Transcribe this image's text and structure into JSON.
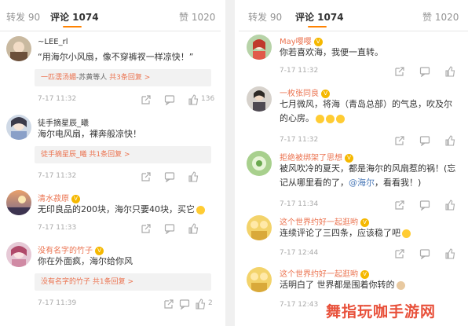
{
  "left": {
    "tabs": {
      "repost": "转发 90",
      "comments": "评论 1074",
      "likes": "赞 1020"
    },
    "comments": [
      {
        "username": "~LEE_rl",
        "text": "“用海尔小风扇，像不穿裤衩一样凉快！”",
        "reply_name": "一匹濡汤媚",
        "reply_sep": "-苏黄等人",
        "reply_count": "共3条回复",
        "time": "7-17 11:32",
        "likes": "136"
      },
      {
        "username": "徒手摘星辰_曦",
        "text": "海尔电风扇，裸奔般凉快！",
        "reply_name": "徒手摘星辰_曦",
        "reply_sep": "",
        "reply_count": "共1条回复",
        "time": "7-17 11:32",
        "likes": ""
      },
      {
        "username": "清水菽原",
        "text": "无印良品的200块，海尔只要40块，买它",
        "time": "7-17 11:33",
        "likes": ""
      },
      {
        "username": "没有名字的竹子",
        "text": "你在外面疯，海尔给你风",
        "reply_name": "没有名字的竹子",
        "reply_sep": "",
        "reply_count": "共1条回复",
        "time": "7-17 11:39",
        "likes": "2"
      }
    ]
  },
  "right": {
    "tabs": {
      "repost": "转发 90",
      "comments": "评论 1074",
      "likes": "赞 1020"
    },
    "comments": [
      {
        "username": "May嘤嘤",
        "text": "你若喜欢海，我便一直转。",
        "time": "7-17 11:32"
      },
      {
        "username": "一枚张同良",
        "text": "七月微风，将海（青岛总部）的气息，吹及尔的心房。",
        "time": "7-17 11:32"
      },
      {
        "username": "拒绝被绑架了思想",
        "text_before": "被风吹冷的夏天，都是海尔的风扇惹的祸！(忘记从哪里看的了，",
        "mention": "@海尔",
        "text_after": "，看看我！)",
        "time": "7-17 11:34"
      },
      {
        "username": "这个世界约好一起逛哟",
        "text": "连续评论了三四条，应该稳了吧",
        "time": "7-17 12:44"
      },
      {
        "username": "这个世界约好一起逛哟",
        "text": "活明白了 世界都是围着你转的",
        "time": "7-17 12:43"
      }
    ]
  },
  "watermark": "舞指玩咖手游网",
  "colors": {
    "accent": "#ff8200",
    "username": "#eb7350",
    "link": "#4a79b8"
  }
}
